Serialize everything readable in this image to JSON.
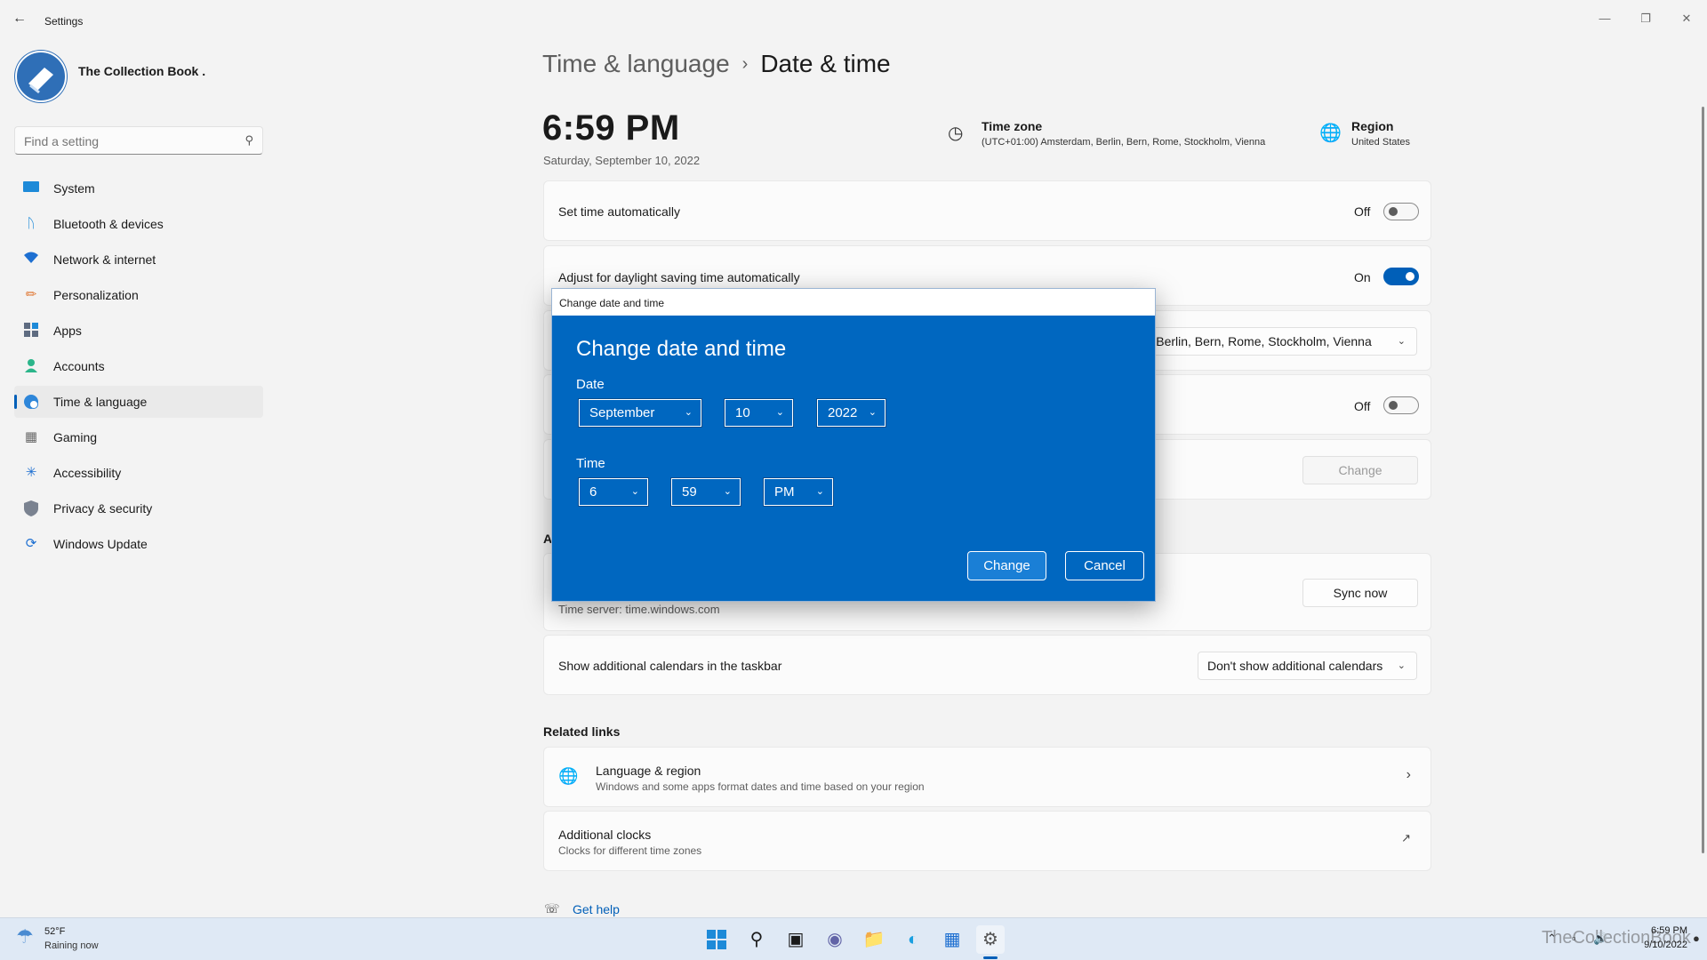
{
  "window": {
    "title": "Settings",
    "back_icon": "arrow-left-icon",
    "controls": [
      "minimize-icon",
      "restore-icon",
      "close-icon"
    ]
  },
  "profile": {
    "name": "The Collection Book ."
  },
  "search": {
    "placeholder": "Find a setting"
  },
  "sidebar": {
    "items": [
      {
        "label": "System",
        "icon": "monitor-icon",
        "active": false
      },
      {
        "label": "Bluetooth & devices",
        "icon": "bluetooth-icon",
        "active": false
      },
      {
        "label": "Network & internet",
        "icon": "wifi-icon",
        "active": false
      },
      {
        "label": "Personalization",
        "icon": "brush-icon",
        "active": false
      },
      {
        "label": "Apps",
        "icon": "apps-icon",
        "active": false
      },
      {
        "label": "Accounts",
        "icon": "person-icon",
        "active": false
      },
      {
        "label": "Time & language",
        "icon": "globe-clock-icon",
        "active": true
      },
      {
        "label": "Gaming",
        "icon": "gamepad-icon",
        "active": false
      },
      {
        "label": "Accessibility",
        "icon": "accessibility-icon",
        "active": false
      },
      {
        "label": "Privacy & security",
        "icon": "shield-icon",
        "active": false
      },
      {
        "label": "Windows Update",
        "icon": "update-icon",
        "active": false
      }
    ]
  },
  "breadcrumb": {
    "parent": "Time & language",
    "separator": "›",
    "current": "Date & time"
  },
  "summary": {
    "time": "6:59 PM",
    "date": "Saturday, September 10, 2022",
    "timezone_title": "Time zone",
    "timezone_value": "(UTC+01:00) Amsterdam, Berlin, Bern, Rome, Stockholm, Vienna",
    "region_title": "Region",
    "region_value": "United States"
  },
  "settings": {
    "set_time_auto": {
      "label": "Set time automatically",
      "state": "Off"
    },
    "daylight_saving": {
      "label": "Adjust for daylight saving time automatically",
      "state": "On"
    },
    "timezone_dropdown": "am, Berlin, Bern, Rome, Stockholm, Vienna",
    "timezone_auto": {
      "state": "Off"
    },
    "manual_change": {
      "button": "Change"
    },
    "additional_settings_header_partial": "A",
    "sync": {
      "sub": "Time server: time.windows.com",
      "button": "Sync now"
    },
    "calendars": {
      "label": "Show additional calendars in the taskbar",
      "value": "Don't show additional calendars"
    }
  },
  "related": {
    "title": "Related links",
    "language_region": {
      "title": "Language & region",
      "sub": "Windows and some apps format dates and time based on your region"
    },
    "additional_clocks": {
      "title": "Additional clocks",
      "sub": "Clocks for different time zones"
    }
  },
  "help": {
    "label": "Get help"
  },
  "dialog": {
    "window_title": "Change date and time",
    "heading": "Change date and time",
    "date_label": "Date",
    "month": "September",
    "day": "10",
    "year": "2022",
    "time_label": "Time",
    "hour": "6",
    "minute": "59",
    "ampm": "PM",
    "change_button": "Change",
    "cancel_button": "Cancel"
  },
  "taskbar": {
    "weather_temp": "52°F",
    "weather_desc": "Raining now",
    "apps": [
      "windows-start-icon",
      "search-icon",
      "task-view-icon",
      "chat-icon",
      "file-explorer-icon",
      "edge-icon",
      "store-icon",
      "settings-icon"
    ],
    "watermark": "TheCollectionBook",
    "clock_time": "6:59 PM",
    "clock_date": "9/10/2022"
  },
  "colors": {
    "accent": "#005fb8",
    "dialog_bg": "#0067c0",
    "background": "#f3f3f3"
  }
}
